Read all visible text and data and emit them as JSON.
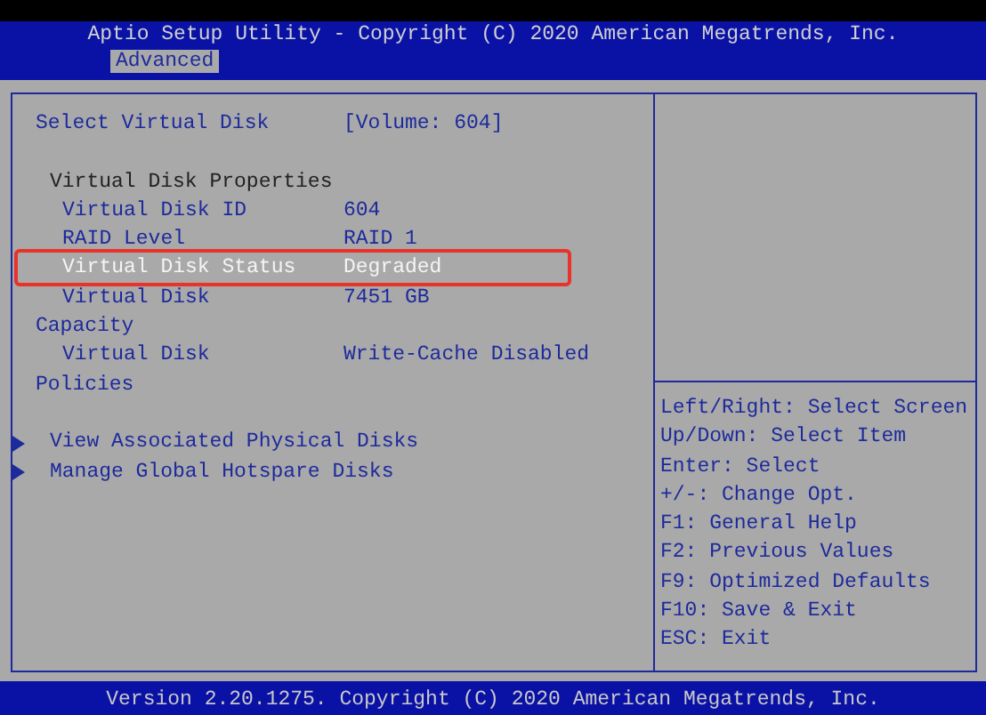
{
  "header": {
    "title": "Aptio Setup Utility - Copyright (C) 2020 American Megatrends, Inc."
  },
  "tabs": [
    {
      "label": "Advanced",
      "selected": true
    }
  ],
  "main": {
    "sections": [
      {
        "rows": [
          {
            "kind": "option",
            "label": "Select Virtual Disk",
            "value": "[Volume: 604]",
            "selected": false,
            "highlighted": false
          }
        ]
      },
      {
        "rows": [
          {
            "kind": "heading",
            "label": "Virtual Disk Properties"
          },
          {
            "kind": "property",
            "label": "Virtual Disk ID",
            "value": "604",
            "selected": false,
            "highlighted": false
          },
          {
            "kind": "property",
            "label": "RAID Level",
            "value": "RAID 1",
            "selected": false,
            "highlighted": false
          },
          {
            "kind": "property",
            "label": "Virtual Disk Status",
            "value": "Degraded",
            "selected": true,
            "highlighted": true
          },
          {
            "kind": "property",
            "label": "Virtual Disk Capacity",
            "value": "7451 GB",
            "selected": false,
            "highlighted": false
          },
          {
            "kind": "property",
            "label": "Virtual Disk Policies",
            "value": "Write-Cache Disabled",
            "selected": false,
            "highlighted": false
          }
        ]
      },
      {
        "rows": [
          {
            "kind": "submenu",
            "label": "View Associated Physical Disks"
          },
          {
            "kind": "submenu",
            "label": "Manage Global Hotspare Disks"
          }
        ]
      }
    ]
  },
  "help": {
    "lines": [
      "Left/Right: Select Screen",
      "Up/Down: Select Item",
      "Enter: Select",
      "+/-: Change Opt.",
      "F1: General Help",
      "F2: Previous Values",
      "F9: Optimized Defaults",
      "F10: Save & Exit",
      "ESC: Exit"
    ]
  },
  "footer": {
    "text": "Version 2.20.1275. Copyright (C) 2020 American Megatrends, Inc."
  }
}
